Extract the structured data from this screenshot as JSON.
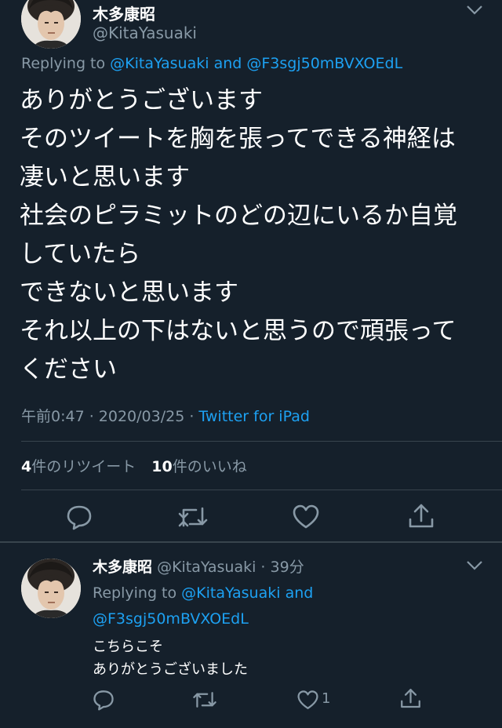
{
  "main_tweet": {
    "display_name": "木多康昭",
    "handle": "@KitaYasuaki",
    "replying_prefix": "Replying to",
    "replying_to_1": "@KitaYasuaki",
    "replying_and": "and",
    "replying_to_2": "@F3sgj50mBVXOEdL",
    "lines": [
      "ありがとうございます",
      "そのツイートを胸を張ってできる神経は",
      "凄いと思います",
      "社会のピラミットのどの辺にいるか自覚",
      "していたら",
      "できないと思います",
      "それ以上の下はないと思うので頑張って",
      "ください"
    ],
    "timestamp": "午前0:47 · 2020/03/25 ·",
    "source": "Twitter for iPad",
    "retweets_count": "4",
    "retweets_label": "件のリツイート",
    "likes_count": "10",
    "likes_label": "件のいいね"
  },
  "reply_tweet": {
    "display_name": "木多康昭",
    "handle_time": "@KitaYasuaki · 39分",
    "replying_prefix": "Replying to",
    "replying_to_1": "@KitaYasuaki",
    "replying_and": "and",
    "replying_to_2": "@F3sgj50mBVXOEdL",
    "lines": [
      "こちらこそ",
      "ありがとうございました"
    ],
    "like_count": "1"
  },
  "icons": {
    "reply": "speech-bubble-icon",
    "retweet": "retweet-arrows-icon",
    "like": "heart-outline-icon",
    "share": "share-upload-icon",
    "menu": "chevron-down-icon"
  },
  "colors": {
    "background": "#15202b",
    "text": "#ffffff",
    "muted": "#8899a6",
    "link": "#1da1f2",
    "divider": "#38444d"
  }
}
